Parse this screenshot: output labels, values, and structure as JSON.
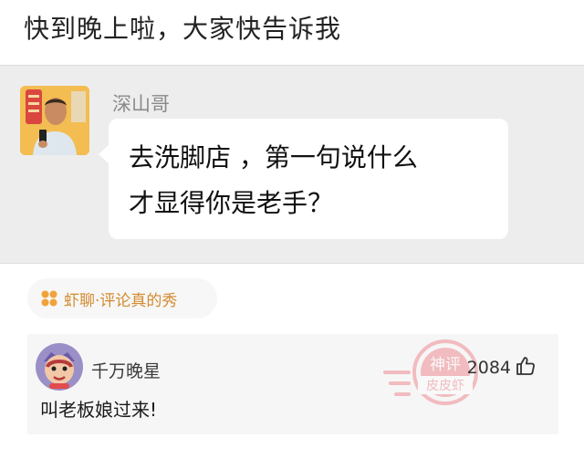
{
  "post": {
    "title": "快到晚上啦，大家快告诉我"
  },
  "chat": {
    "sender_name": "深山哥",
    "message_line1": "去洗脚店 ，第一句说什么",
    "message_line2": "才显得你是老手？"
  },
  "section_tag": {
    "icon": "four-dots-icon",
    "label": "虾聊·评论真的秀"
  },
  "comment": {
    "username": "千万晚星",
    "text": "叫老板娘过来!",
    "like_count": "2084",
    "like_icon": "thumbs-up-icon",
    "stamp_line1": "神评",
    "stamp_line2": "皮皮虾"
  },
  "colors": {
    "accent_orange": "#d38a2f",
    "stamp_red": "#e8505b",
    "chat_bg": "#ededed"
  }
}
